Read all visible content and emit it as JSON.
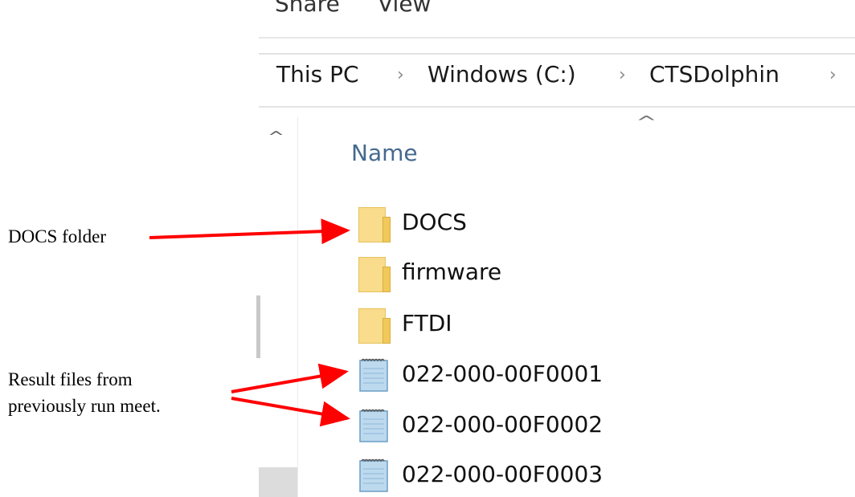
{
  "ribbon": {
    "tabs": [
      {
        "label": "Share"
      },
      {
        "label": "View"
      }
    ]
  },
  "address_bar": {
    "crumbs": [
      "This PC",
      "Windows (C:)",
      "CTSDolphin"
    ],
    "separator": "›"
  },
  "file_list": {
    "column_name": "Name",
    "sort_indicator": "^",
    "nav_scroll_up": "^",
    "items": [
      {
        "name": "DOCS",
        "type": "folder",
        "icon": "folder-icon"
      },
      {
        "name": "firmware",
        "type": "folder",
        "icon": "folder-icon"
      },
      {
        "name": "FTDI",
        "type": "folder",
        "icon": "folder-icon"
      },
      {
        "name": "022-000-00F0001",
        "type": "text-file",
        "icon": "text-file-icon"
      },
      {
        "name": "022-000-00F0002",
        "type": "text-file",
        "icon": "text-file-icon"
      },
      {
        "name": "022-000-00F0003",
        "type": "text-file",
        "icon": "text-file-icon"
      }
    ]
  },
  "annotations": {
    "docs_label": "DOCS folder",
    "results_label_line1": "Result files from",
    "results_label_line2": "previously run meet.",
    "arrow_color": "#ff0000"
  }
}
